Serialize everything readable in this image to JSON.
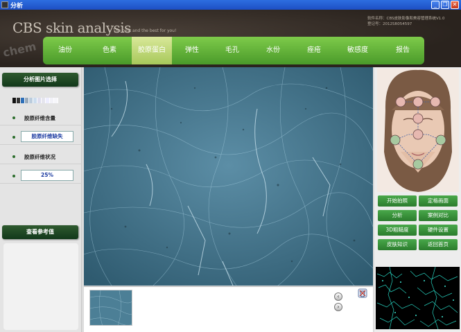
{
  "window": {
    "title": "分析",
    "minimize_glyph": "_",
    "restore_glyph": "❐",
    "close_glyph": "✕"
  },
  "header": {
    "brand": "CBS skin analysis",
    "tagline": "The best and the best for you!",
    "software_name": "软件名称：CBS皮肤影像和美容管理系统V1.0",
    "registration": "登记号：2012SR054597",
    "watermark": "chem"
  },
  "nav": {
    "items": [
      {
        "label": "油份"
      },
      {
        "label": "色素"
      },
      {
        "label": "胶原蛋白"
      },
      {
        "label": "弹性"
      },
      {
        "label": "毛孔"
      },
      {
        "label": "水份"
      },
      {
        "label": "痤疮"
      },
      {
        "label": "敏感度"
      },
      {
        "label": "报告"
      }
    ],
    "active": "胶原蛋白"
  },
  "left_panel": {
    "header": "分析图片选择",
    "content_label": "胶原纤维含量",
    "content_value": "胶原纤维缺失",
    "status_label": "胶原纤维状况",
    "status_value": "25%",
    "reference_header": "查看参考值"
  },
  "thumbnail_strip": {
    "prev_glyph": "‹",
    "next_glyph": "›"
  },
  "right_panel": {
    "buttons": [
      {
        "label": "开始拍照"
      },
      {
        "label": "定格画面"
      },
      {
        "label": "分析"
      },
      {
        "label": "案例对比"
      },
      {
        "label": "3D粗糙度"
      },
      {
        "label": "硬件设置"
      },
      {
        "label": "皮肤知识"
      },
      {
        "label": "返回首页"
      }
    ]
  },
  "colors": {
    "nav_green": "#5aa834",
    "active_tab": "#c4d97a",
    "panel_header": "#1f4a24",
    "button_green": "#3a8f3c",
    "collagen_blue": "#3f6f86"
  }
}
